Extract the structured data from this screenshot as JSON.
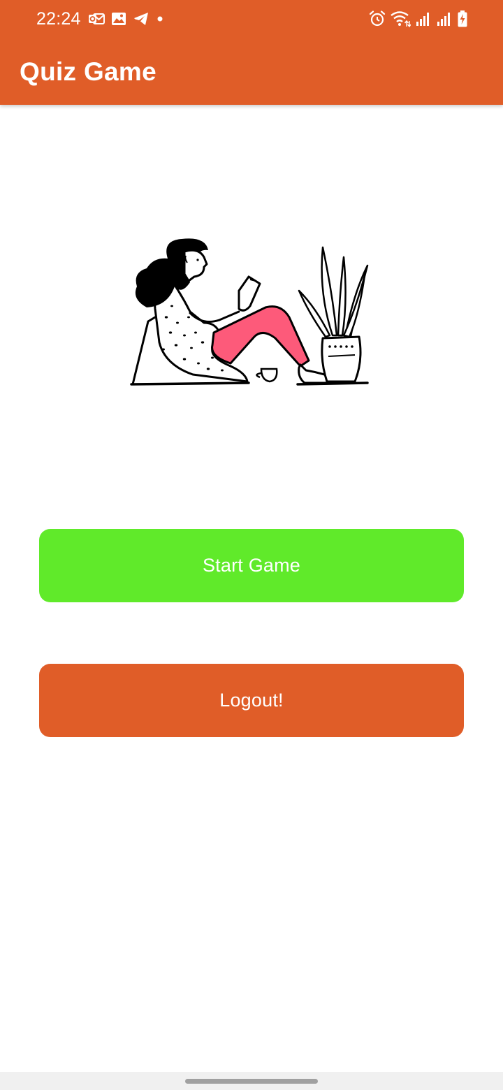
{
  "status_bar": {
    "time": "22:24",
    "left_icons": [
      "outlook-icon",
      "gallery-icon",
      "telegram-icon",
      "notification-dot-icon"
    ],
    "right_icons": [
      "alarm-icon",
      "wifi-icon",
      "signal-icon",
      "signal-icon",
      "battery-charging-icon"
    ]
  },
  "app_bar": {
    "title": "Quiz Game"
  },
  "illustration": {
    "name": "woman-reading-illustration"
  },
  "buttons": {
    "start_label": "Start Game",
    "logout_label": "Logout!"
  },
  "colors": {
    "primary": "#e05d28",
    "start_button": "#60ea2a",
    "logout_button": "#e05d28",
    "pants": "#fd5a7a",
    "background": "#ffffff"
  }
}
